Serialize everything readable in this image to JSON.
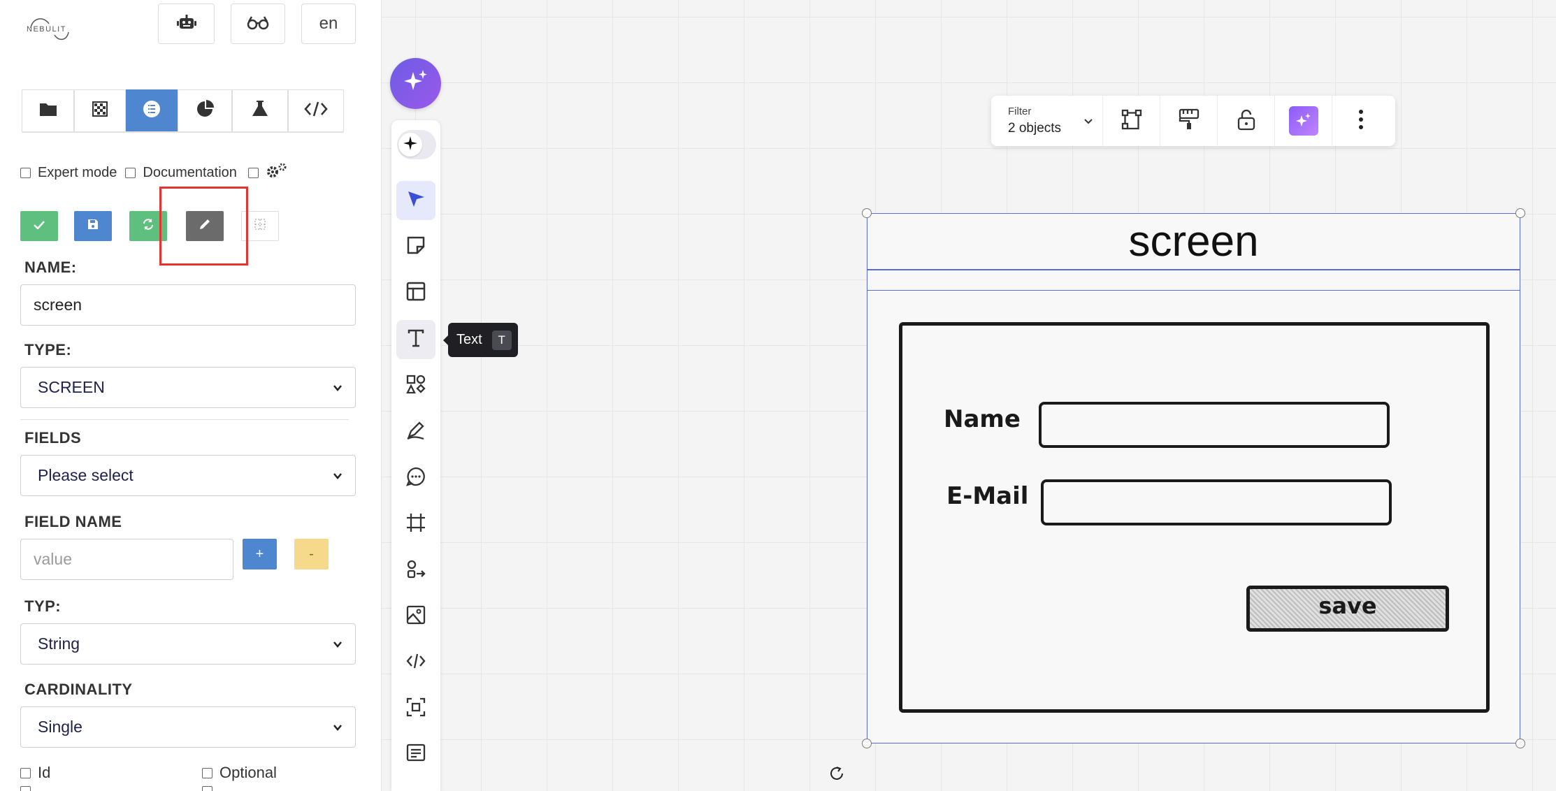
{
  "app": {
    "logo_text": "NEBULIT",
    "lang_button": "en"
  },
  "left_panel": {
    "tabs": [
      "folder",
      "grid",
      "list",
      "chart",
      "flask",
      "code"
    ],
    "active_tab": "list",
    "checkboxes": {
      "expert_mode": "Expert mode",
      "documentation": "Documentation"
    },
    "name_label": "NAME:",
    "name_value": "screen",
    "type_label": "TYPE:",
    "type_value": "SCREEN",
    "fields_label": "FIELDS",
    "fields_value": "Please select",
    "field_name_label": "FIELD NAME",
    "field_name_placeholder": "value",
    "plus_label": "+",
    "minus_label": "-",
    "typ_label": "TYP:",
    "typ_value": "String",
    "cardinality_label": "CARDINALITY",
    "cardinality_value": "Single",
    "id_label": "Id",
    "optional_label": "Optional"
  },
  "toolbar": {
    "tooltip_text": "Text",
    "tooltip_key": "T"
  },
  "context_bar": {
    "filter_label": "Filter",
    "filter_value": "2 objects"
  },
  "frame": {
    "title": "screen"
  },
  "sketch": {
    "name_label": "Name",
    "email_label": "E-Mail",
    "save_label": "save"
  },
  "colors": {
    "primary_blue": "#4e86cf",
    "green": "#5fbf7f",
    "gray": "#6b6b6b",
    "yellow": "#f6d98a",
    "highlight_red": "#e3342f",
    "selection_blue": "#5b6cd6",
    "ai_purple": "#6c5ce7"
  }
}
